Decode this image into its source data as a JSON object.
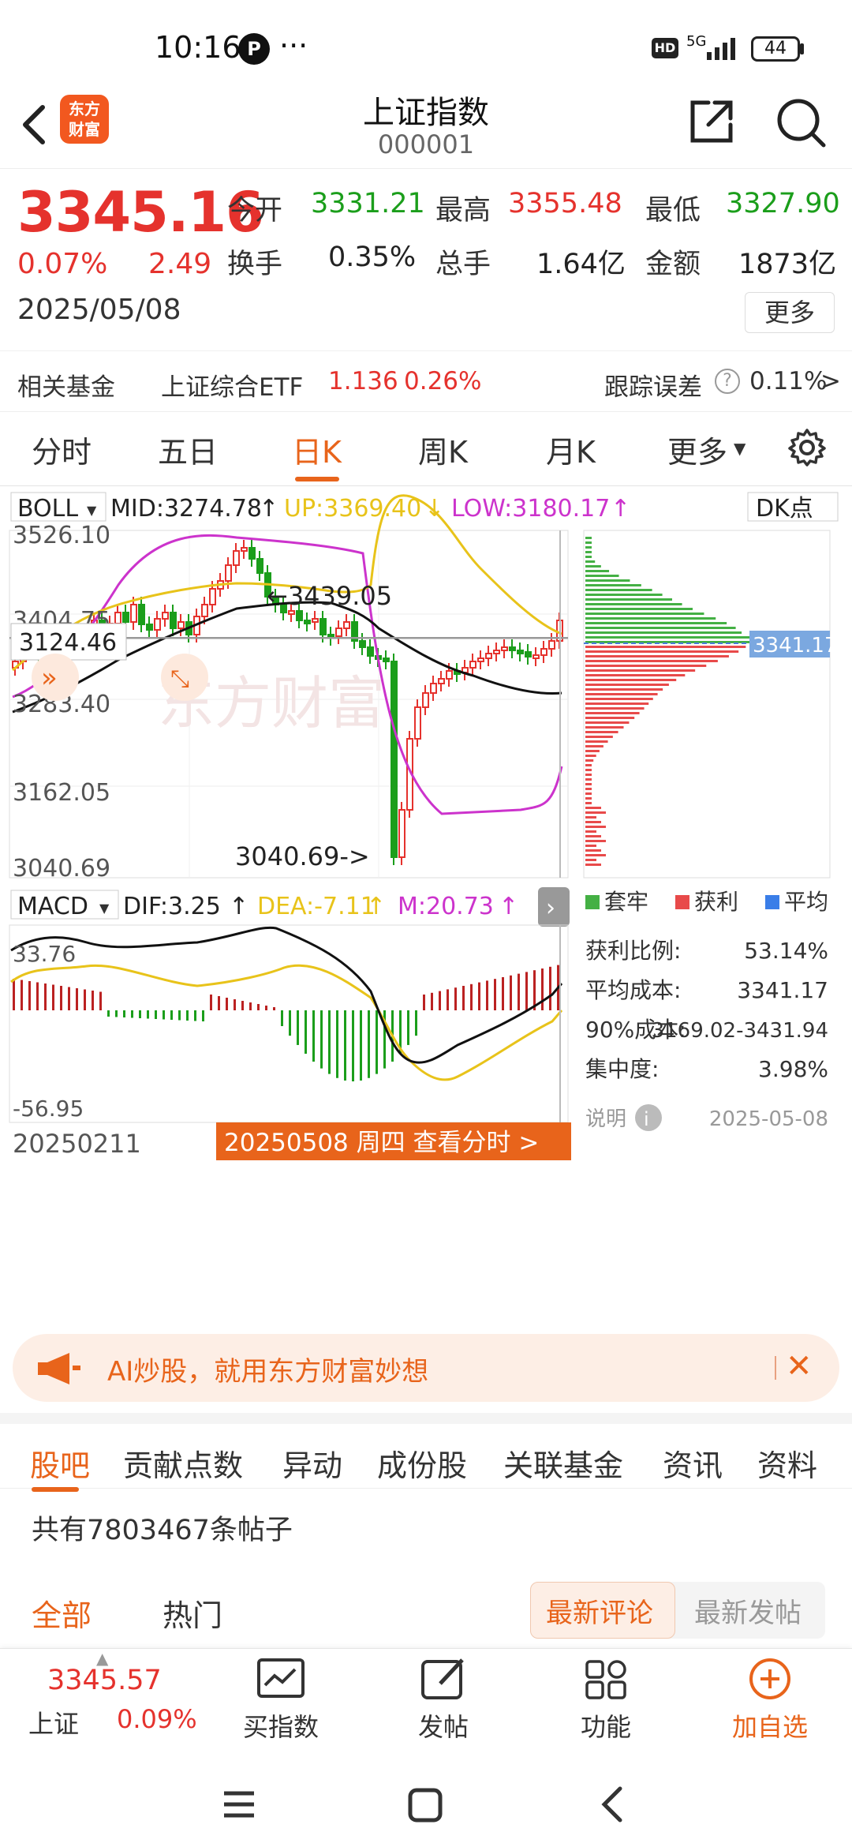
{
  "status": {
    "time": "10:16",
    "dots": "···",
    "notif_glyph": "P",
    "hd": "HD",
    "network": "5G",
    "battery": "44"
  },
  "header": {
    "logo_line1": "东方",
    "logo_line2": "财富",
    "title": "上证指数",
    "code": "000001"
  },
  "quote": {
    "price": "3345.16",
    "change_pct": "0.07%",
    "change": "2.49",
    "date": "2025/05/08",
    "open_label": "今开",
    "open": "3331.21",
    "high_label": "最高",
    "high": "3355.48",
    "low_label": "最低",
    "low": "3327.90",
    "turnover_label": "换手",
    "turnover": "0.35%",
    "volume_label": "总手",
    "volume": "1.64亿",
    "amount_label": "金额",
    "amount": "1873亿",
    "more": "更多"
  },
  "fund": {
    "label": "相关基金",
    "name": "上证综合ETF",
    "price": "1.136",
    "pct": "0.26%",
    "error_label": "跟踪误差",
    "error": "0.11%",
    "help": "?",
    "chevron": ">"
  },
  "tabs": [
    "分时",
    "五日",
    "日K",
    "周K",
    "月K",
    "更多"
  ],
  "tabs_active": "日K",
  "chart": {
    "boll_name": "BOLL",
    "mid": "MID:3274.78",
    "up": "UP:3369.40",
    "low": "LOW:3180.17",
    "dk": "DK点",
    "y_ticks": [
      "3526.10",
      "3404.75",
      "3283.40",
      "3162.05",
      "3040.69"
    ],
    "crosshair_price": "3124.46",
    "high_marker": "3439.05",
    "low_marker": "3040.69",
    "macd_name": "MACD",
    "dif": "DIF:3.25",
    "dea": "DEA:-7.11",
    "m": "M:20.73",
    "macd_top": "33.76",
    "macd_bottom": "-56.95",
    "start_date": "20250211",
    "banner": "20250508 周四 查看分时 >",
    "cost_price": "3341.17",
    "legend": [
      "套牢",
      "获利",
      "平均"
    ],
    "stats": [
      {
        "label": "获利比例:",
        "value": "53.14%"
      },
      {
        "label": "平均成本:",
        "value": "3341.17"
      },
      {
        "label": "90%成本:",
        "value": "3169.02-3431.94"
      },
      {
        "label": "集中度:",
        "value": "3.98%"
      }
    ],
    "note_label": "说明",
    "note_date": "2025-05-08",
    "watermark": "东方财富"
  },
  "chart_data": {
    "type": "candlestick",
    "y_axis_ticks": [
      3526.1,
      3404.75,
      3283.4,
      3162.05,
      3040.69
    ],
    "visible_high": 3439.05,
    "visible_low": 3040.69,
    "macd_range": [
      -56.95,
      33.76
    ]
  },
  "ad": {
    "text": "AI炒股，就用东方财富妙想"
  },
  "subtabs": [
    "股吧",
    "贡献点数",
    "异动",
    "成份股",
    "关联基金",
    "资讯",
    "资料"
  ],
  "posts": "共有7803467条帖子",
  "filters": {
    "all": "全部",
    "hot": "热门",
    "latest_comment": "最新评论",
    "latest_post": "最新发帖"
  },
  "bottomnav": {
    "index_price": "3345.57",
    "index_name": "上证",
    "index_pct": "0.09%",
    "buy": "买指数",
    "post": "发帖",
    "func": "功能",
    "add": "加自选"
  },
  "colors": {
    "accent": "#e8641b",
    "up": "#e5322d",
    "down": "#1b9e1b",
    "boll_up": "#e8c31a",
    "boll_low": "#cc33cc"
  }
}
